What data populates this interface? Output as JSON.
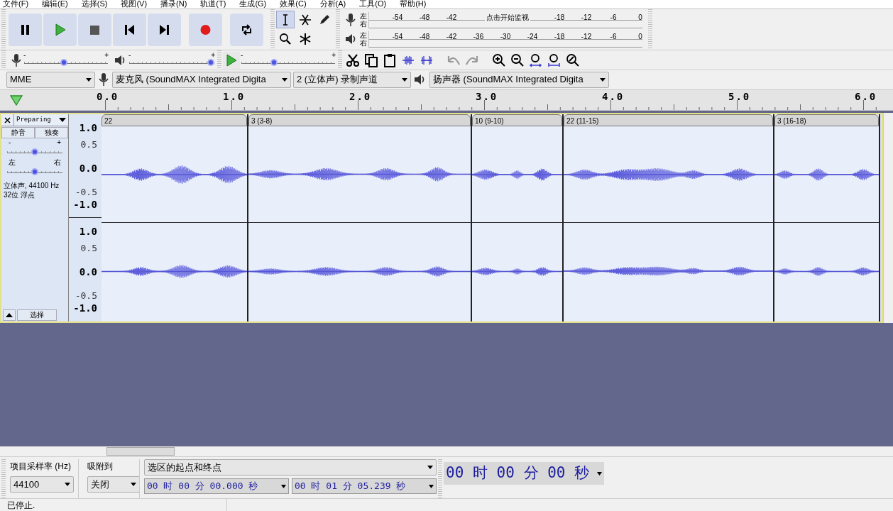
{
  "menu": [
    "文件(F)",
    "编辑(E)",
    "选择(S)",
    "视图(V)",
    "播录(N)",
    "轨道(T)",
    "生成(G)",
    "效果(C)",
    "分析(A)",
    "工具(O)",
    "帮助(H)"
  ],
  "tools": [
    {
      "kind": "select",
      "selected": true
    },
    {
      "kind": "envelope",
      "selected": false
    },
    {
      "kind": "draw",
      "selected": false
    },
    {
      "kind": "zoom",
      "selected": false
    },
    {
      "kind": "multi",
      "selected": false
    }
  ],
  "meters": {
    "record": {
      "channels": [
        "左",
        "右"
      ],
      "scale": [
        "-54",
        "-48",
        "-42",
        "-18",
        "-12",
        "-6",
        "0"
      ],
      "prompt": "点击开始监视"
    },
    "playback": {
      "channels": [
        "左",
        "右"
      ],
      "scale": [
        "-54",
        "-48",
        "-42",
        "-36",
        "-30",
        "-24",
        "-18",
        "-12",
        "-6",
        "0"
      ]
    }
  },
  "mixer": {
    "record": {
      "minus": "-",
      "plus": "+",
      "level": 0.47
    },
    "playback": {
      "minus": "-",
      "plus": "+",
      "level": 1.0
    },
    "play_at_speed": {
      "minus": "-",
      "plus": "+",
      "level": 0.34
    }
  },
  "devices": {
    "host": "MME",
    "input": "麦克风 (SoundMAX Integrated Digita",
    "channels": "2 (立体声) 录制声道",
    "output": "扬声器 (SoundMAX Integrated Digita"
  },
  "ruler": [
    "0.0",
    "1.0",
    "2.0",
    "3.0",
    "4.0",
    "5.0",
    "6.0"
  ],
  "track": {
    "name": "Preparing",
    "buttons": [
      "静音",
      "独奏"
    ],
    "gain": {
      "minus": "-",
      "plus": "+",
      "level": 0.5
    },
    "pan": {
      "left": "左",
      "right": "右",
      "level": 0.5
    },
    "info": [
      "立体声, 44100 Hz",
      "32位 浮点"
    ],
    "select": "选择",
    "scales": [
      [
        "1.0",
        "0.5",
        "0.0",
        "-0.5",
        "-1.0"
      ],
      [
        "1.0",
        "0.5",
        "0.0",
        "-0.5",
        "-1.0"
      ]
    ],
    "clips": [
      {
        "name": "22"
      },
      {
        "name": "3 (3-8)"
      },
      {
        "name": "10 (9-10)"
      },
      {
        "name": "22 (11-15)"
      },
      {
        "name": "3 (16-18)"
      }
    ]
  },
  "selection_toolbar": {
    "rate_label": "项目采样率 (Hz)",
    "snap_label": "吸附到",
    "mode": "选区的起点和终点",
    "rate": "44100",
    "snap": "关闭",
    "start": "00 时 00 分 00.000 秒",
    "end": "00 时 01 分 05.239 秒"
  },
  "time": "00 时 00 分 00 秒",
  "status": "已停止."
}
